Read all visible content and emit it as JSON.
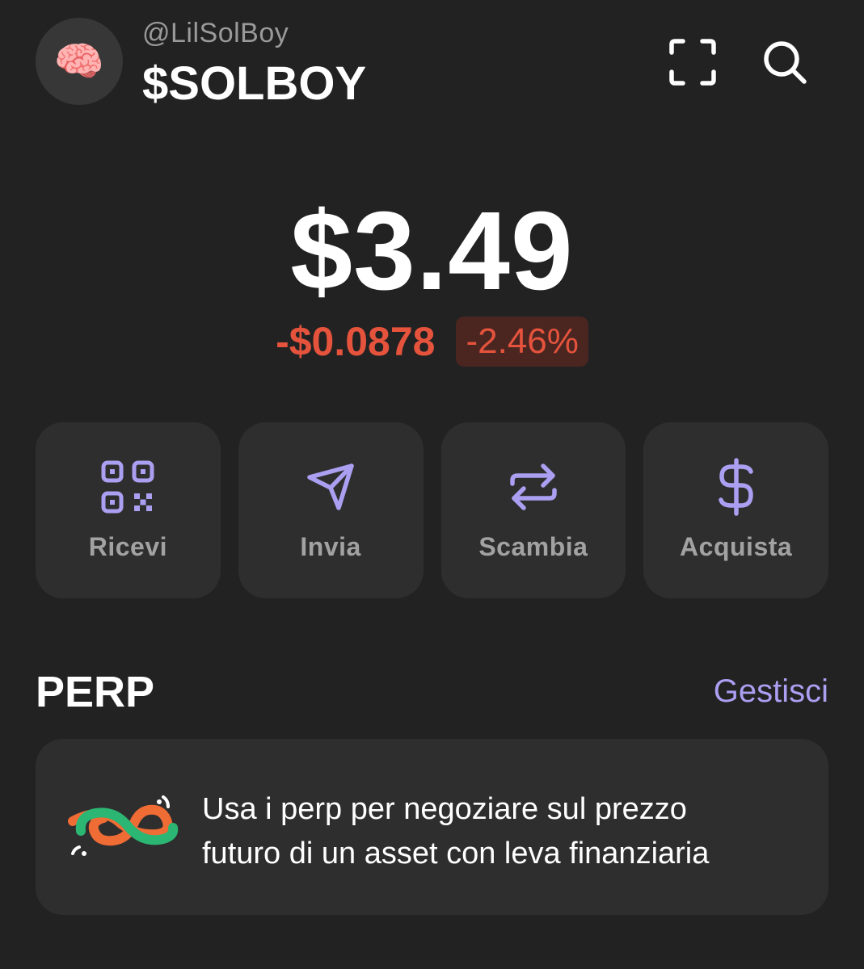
{
  "header": {
    "handle": "@LilSolBoy",
    "account_name": "$SOLBOY",
    "avatar_emoji": "🧠",
    "scan_icon": "scan-icon",
    "search_icon": "search-icon"
  },
  "balance": {
    "value": "$3.49",
    "change_amount": "-$0.0878",
    "change_percent": "-2.46%",
    "change_color": "#e5533d"
  },
  "actions": [
    {
      "label": "Ricevi",
      "icon": "qr-code-icon"
    },
    {
      "label": "Invia",
      "icon": "send-icon"
    },
    {
      "label": "Scambia",
      "icon": "swap-icon"
    },
    {
      "label": "Acquista",
      "icon": "dollar-icon"
    }
  ],
  "perp": {
    "title": "PERP",
    "link": "Gestisci",
    "description_line1": "Usa i perp per negoziare sul prezzo",
    "description_line2": "futuro di un asset con leva finanziaria"
  },
  "colors": {
    "background": "#222222",
    "card": "#2e2e2e",
    "accent": "#ab9ff2",
    "negative": "#e5533d"
  }
}
